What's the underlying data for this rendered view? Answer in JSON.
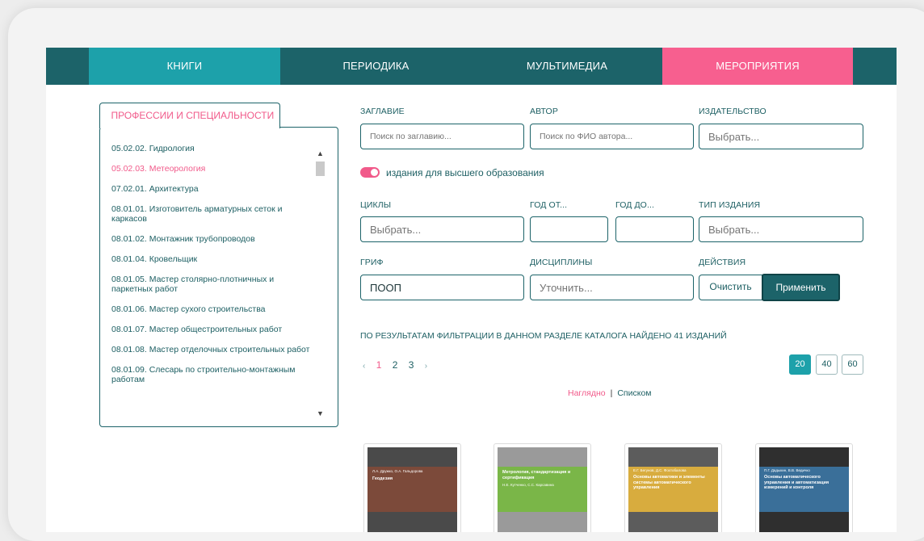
{
  "topnav": {
    "tabs": [
      {
        "label": "КНИГИ"
      },
      {
        "label": "ПЕРИОДИКА"
      },
      {
        "label": "МУЛЬТИМЕДИА"
      },
      {
        "label": "МЕРОПРИЯТИЯ"
      }
    ]
  },
  "sidebar": {
    "tab_label": "ПРОФЕССИИ И СПЕЦИАЛЬНОСТИ",
    "items": [
      {
        "label": "05.02.02. Гидрология"
      },
      {
        "label": "05.02.03. Метеорология"
      },
      {
        "label": "07.02.01. Архитектура"
      },
      {
        "label": "08.01.01. Изготовитель арматурных сеток и каркасов"
      },
      {
        "label": "08.01.02. Монтажник трубопроводов"
      },
      {
        "label": "08.01.04. Кровельщик"
      },
      {
        "label": "08.01.05. Мастер столярно-плотничных и паркетных работ"
      },
      {
        "label": "08.01.06. Мастер сухого строительства"
      },
      {
        "label": "08.01.07. Мастер общестроительных работ"
      },
      {
        "label": "08.01.08. Мастер отделочных строительных работ"
      },
      {
        "label": "08.01.09. Слесарь по строительно-монтажным работам"
      }
    ],
    "selected_index": 1
  },
  "filters": {
    "title_label": "ЗАГЛАВИЕ",
    "title_placeholder": "Поиск по заглавию...",
    "author_label": "АВТОР",
    "author_placeholder": "Поиск по ФИО автора...",
    "publisher_label": "ИЗДАТЕЛЬСТВО",
    "publisher_placeholder": "Выбрать...",
    "higher_ed_toggle_label": "издания для высшего образования",
    "higher_ed_toggle_on": true,
    "cycles_label": "ЦИКЛЫ",
    "cycles_placeholder": "Выбрать...",
    "year_from_label": "ГОД ОТ...",
    "year_to_label": "ГОД ДО...",
    "type_label": "ТИП ИЗДАНИЯ",
    "type_placeholder": "Выбрать...",
    "grif_label": "ГРИФ",
    "grif_value": "ПООП",
    "disciplines_label": "ДИСЦИПЛИНЫ",
    "disciplines_placeholder": "Уточнить...",
    "actions_label": "ДЕЙСТВИЯ",
    "clear_label": "Очистить",
    "apply_label": "Применить"
  },
  "results": {
    "summary": "ПО РЕЗУЛЬТАТАМ ФИЛЬТРАЦИИ В ДАННОМ РАЗДЕЛЕ КАТАЛОГА НАЙДЕНО 41 ИЗДАНИЙ"
  },
  "pagination": {
    "prev": "‹",
    "pages": [
      "1",
      "2",
      "3"
    ],
    "current": "1",
    "next": "›"
  },
  "per_page": {
    "options": [
      "20",
      "40",
      "60"
    ],
    "selected": "20"
  },
  "view": {
    "visual_label": "Наглядно",
    "separator": "|",
    "list_label": "Списком"
  },
  "books": [
    {
      "title": "Геодезия",
      "authors": "Л.А. Дружко, О.А. Гальдорова",
      "color": "#7c4a3a"
    },
    {
      "title": "Метрология, стандартизация и сертификация",
      "authors": "Н.Е. Кутченко, С.С. Карсавина",
      "color": "#7ab648"
    },
    {
      "title": "Основы автоматики и элементы системы автоматического управления",
      "authors": "Е.Г. Бегунов, Д.С. Фохтобалова",
      "color": "#d8ac3e"
    },
    {
      "title": "Основы автоматического управления и автоматизация измерений и контроля",
      "authors": "П.Г. Дадыкин, В.В. Ведичко",
      "color": "#3a6f99"
    }
  ]
}
